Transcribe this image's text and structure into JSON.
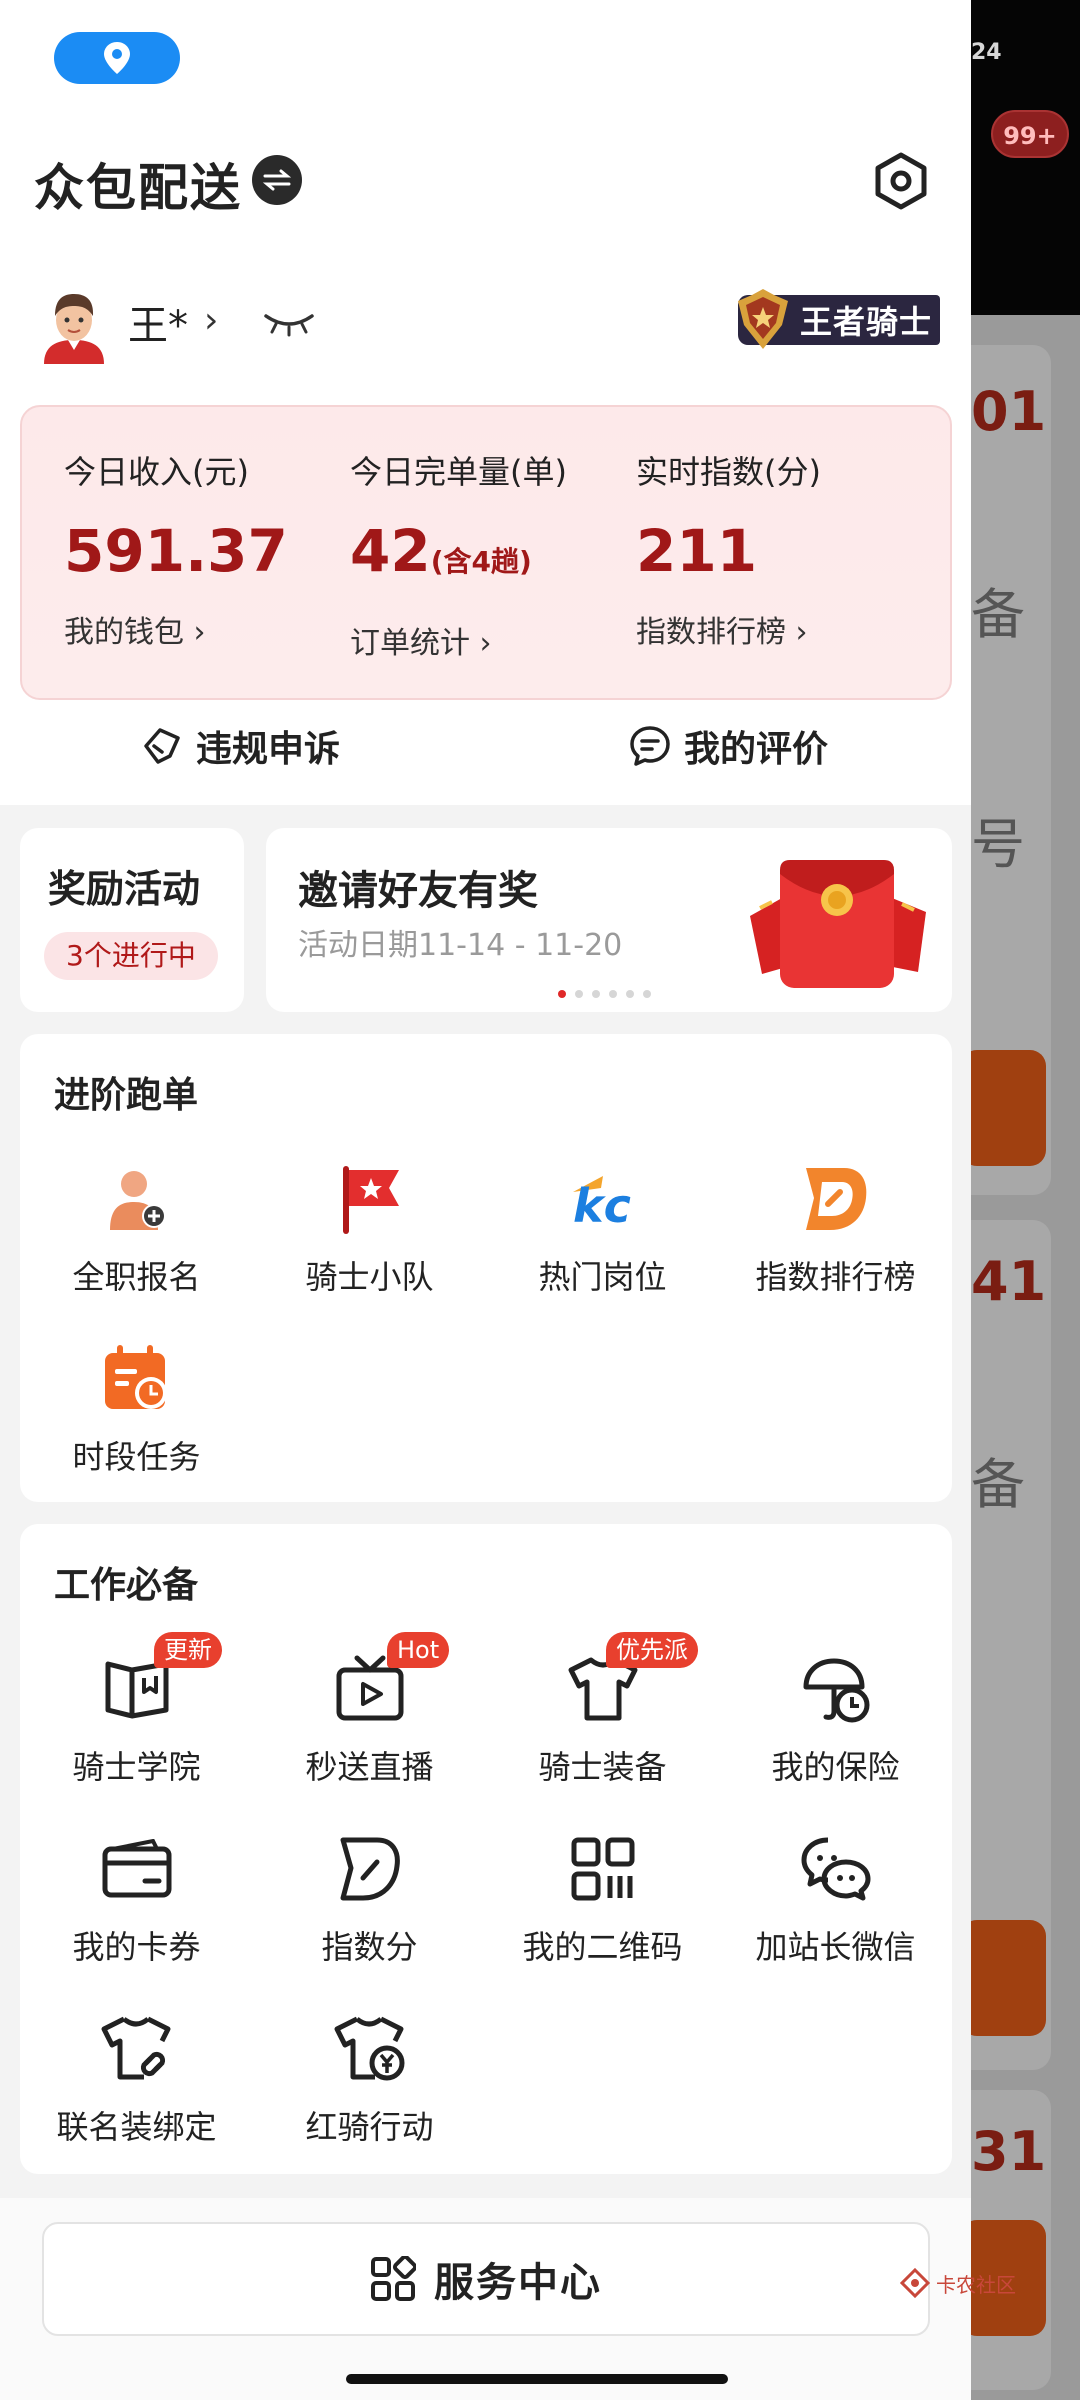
{
  "status": {
    "battery": "24"
  },
  "background_page": {
    "notification_badge": "99+",
    "numbers": [
      "01",
      "41",
      "31"
    ],
    "chars": [
      "备",
      "号",
      "备"
    ]
  },
  "header": {
    "app_title": "众包配送",
    "user_name": "王*",
    "rank": "王者骑士"
  },
  "stats": [
    {
      "label": "今日收入(元)",
      "value": "591.37",
      "suffix": "",
      "link": "我的钱包"
    },
    {
      "label": "今日完单量(单)",
      "value": "42",
      "suffix": "(含4趟)",
      "link": "订单统计"
    },
    {
      "label": "实时指数(分)",
      "value": "211",
      "suffix": "",
      "link": "指数排行榜"
    }
  ],
  "actions": {
    "appeal": "违规申诉",
    "reviews": "我的评价"
  },
  "promo": {
    "rewards_title": "奖励活动",
    "rewards_tag": "3个进行中",
    "banner_title": "邀请好友有奖",
    "banner_subtitle": "活动日期11-14 - 11-20",
    "banner_dots": 6,
    "banner_active_dot": 0
  },
  "advanced": {
    "title": "进阶跑单",
    "items": [
      {
        "label": "全职报名",
        "icon": "fulltime-signup-icon"
      },
      {
        "label": "骑士小队",
        "icon": "team-flag-icon"
      },
      {
        "label": "热门岗位",
        "icon": "hot-jobs-icon"
      },
      {
        "label": "指数排行榜",
        "icon": "index-ranking-icon"
      },
      {
        "label": "时段任务",
        "icon": "time-task-icon"
      }
    ]
  },
  "essentials": {
    "title": "工作必备",
    "items": [
      {
        "label": "骑士学院",
        "icon": "book-icon",
        "tag": "更新"
      },
      {
        "label": "秒送直播",
        "icon": "live-tv-icon",
        "tag": "Hot"
      },
      {
        "label": "骑士装备",
        "icon": "tshirt-icon",
        "tag": "优先派"
      },
      {
        "label": "我的保险",
        "icon": "insurance-umbrella-icon",
        "tag": ""
      },
      {
        "label": "我的卡券",
        "icon": "card-icon",
        "tag": ""
      },
      {
        "label": "指数分",
        "icon": "index-score-icon",
        "tag": ""
      },
      {
        "label": "我的二维码",
        "icon": "qr-code-icon",
        "tag": ""
      },
      {
        "label": "加站长微信",
        "icon": "wechat-icon",
        "tag": ""
      },
      {
        "label": "联名装绑定",
        "icon": "shirt-link-icon",
        "tag": ""
      },
      {
        "label": "红骑行动",
        "icon": "shirt-yen-icon",
        "tag": ""
      }
    ]
  },
  "footer": {
    "service_center": "服务中心"
  },
  "watermark": "卡农社区",
  "colors": {
    "accent_red": "#a01818",
    "location_blue": "#1b8cf4",
    "orange": "#f06a24"
  }
}
